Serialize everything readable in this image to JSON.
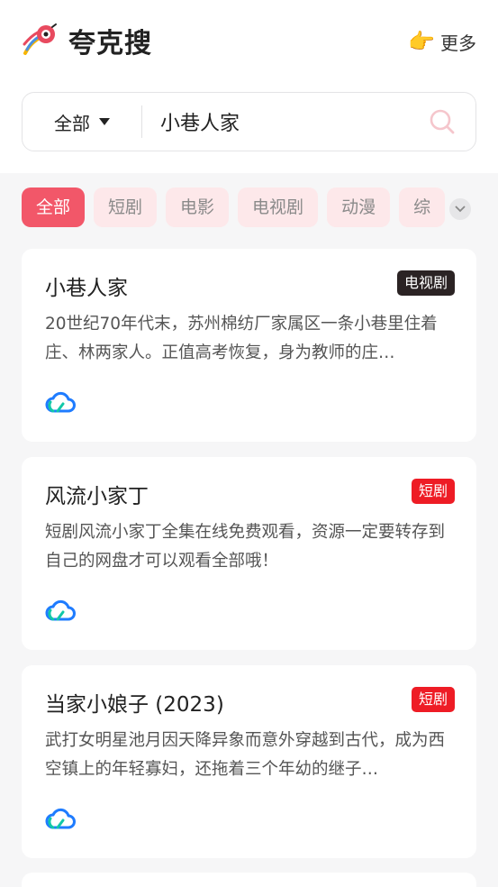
{
  "header": {
    "title": "夸克搜",
    "logo_icon": "rocket-logo-icon",
    "more_label": "更多",
    "more_icon": "pointing-hand-icon"
  },
  "search": {
    "scope_label": "全部",
    "query": "小巷人家",
    "search_icon": "search-icon"
  },
  "tabs": [
    {
      "label": "全部",
      "active": true
    },
    {
      "label": "短剧",
      "active": false
    },
    {
      "label": "电影",
      "active": false
    },
    {
      "label": "电视剧",
      "active": false
    },
    {
      "label": "动漫",
      "active": false
    },
    {
      "label": "综",
      "active": false
    }
  ],
  "results": [
    {
      "title": "小巷人家",
      "badge": "电视剧",
      "badge_color": "#2b2324",
      "desc": "20世纪70年代末，苏州棉纺厂家属区一条小巷里住着庄、林两家人。正值高考恢复，身为教师的庄…",
      "icon": "cloud-drive-icon"
    },
    {
      "title": "风流小家丁",
      "badge": "短剧",
      "badge_color": "#ee1c25",
      "desc": "短剧风流小家丁全集在线免费观看，资源一定要转存到自己的网盘才可以观看全部哦！",
      "icon": "cloud-drive-icon"
    },
    {
      "title": "当家小娘子 (2023)",
      "badge": "短剧",
      "badge_color": "#ee1c25",
      "desc": "武打女明星池月因天降异象而意外穿越到古代，成为西空镇上的年轻寡妇，还拖着三个年幼的继子…",
      "icon": "cloud-drive-icon"
    }
  ],
  "colors": {
    "accent": "#f25769",
    "tab_bg": "#fde8ea",
    "page_bg": "#f6f6f7"
  }
}
